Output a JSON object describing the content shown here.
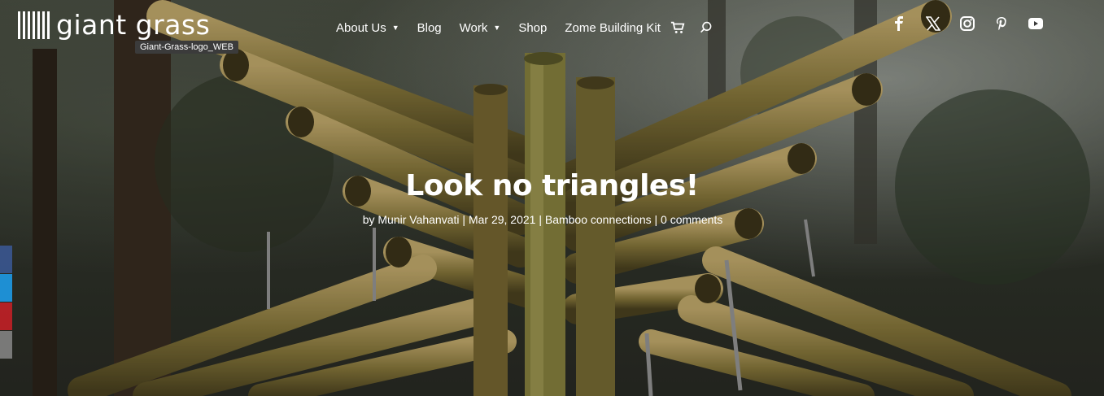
{
  "header": {
    "logo_text": "giant grass",
    "logo_tooltip": "Giant-Grass-logo_WEB",
    "nav": [
      {
        "label": "About Us",
        "dropdown": true
      },
      {
        "label": "Blog",
        "dropdown": false
      },
      {
        "label": "Work",
        "dropdown": true
      },
      {
        "label": "Shop",
        "dropdown": false
      },
      {
        "label": "Zome Building Kit",
        "dropdown": false
      }
    ],
    "icons": [
      "cart-icon",
      "search-icon"
    ],
    "social": [
      "facebook-icon",
      "x-icon",
      "instagram-icon",
      "pinterest-icon",
      "youtube-icon"
    ]
  },
  "post": {
    "title": "Look no triangles!",
    "by": "by ",
    "author": "Munir Vahanvati",
    "sep": " | ",
    "date": "Mar 29, 2021",
    "category": "Bamboo connections",
    "comments": "0 comments"
  },
  "share_bar": {
    "colors": [
      "#3b5998",
      "#1da1f2",
      "#cb2027",
      "#888888"
    ]
  }
}
